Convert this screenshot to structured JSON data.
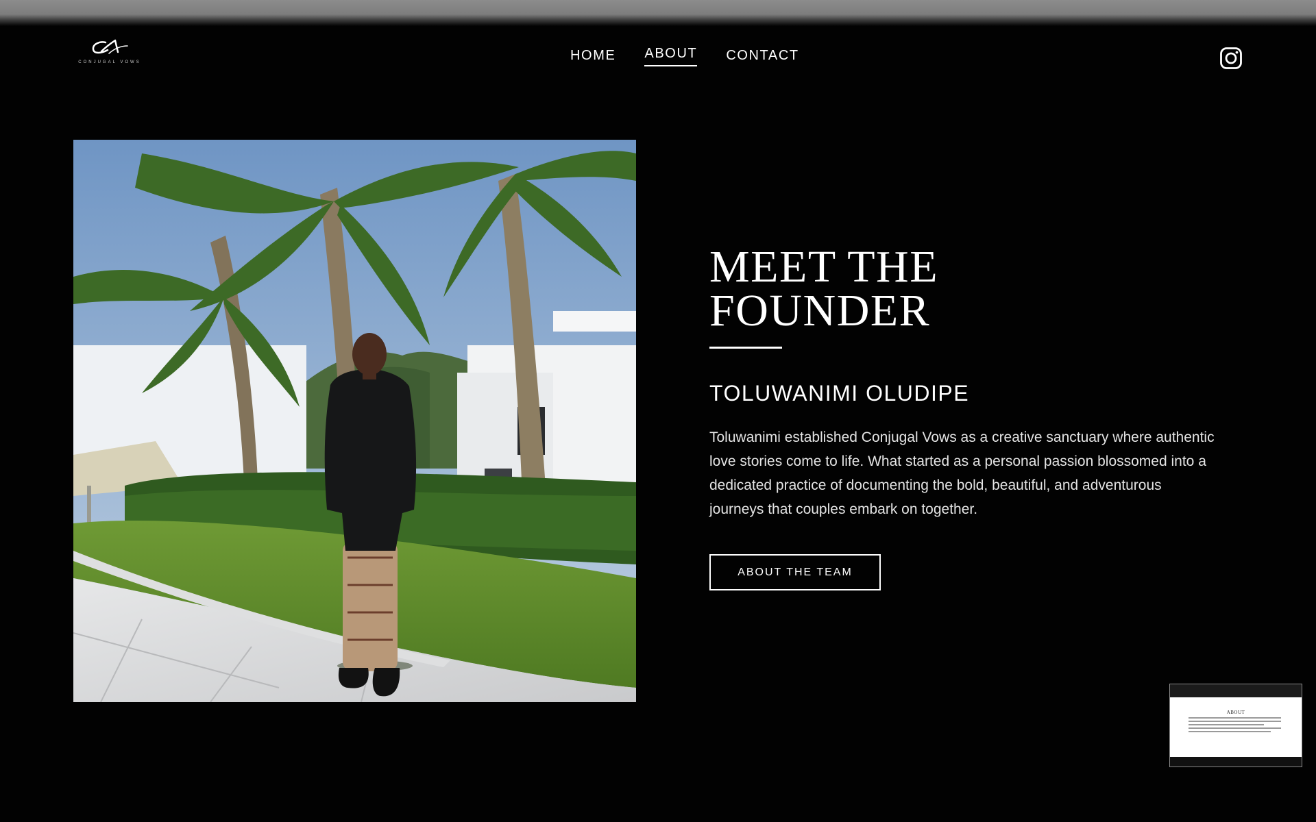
{
  "brand": {
    "monogram": "CV",
    "name": "CONJUGAL VOWS"
  },
  "nav": {
    "items": [
      {
        "label": "HOME",
        "active": false
      },
      {
        "label": "ABOUT",
        "active": true
      },
      {
        "label": "CONTACT",
        "active": false
      }
    ]
  },
  "social": {
    "icon": "instagram-icon"
  },
  "photo": {
    "icon": "founder-photo"
  },
  "hero": {
    "title": "MEET THE\nFOUNDER",
    "founder_name": "TOLUWANIMI OLUDIPE",
    "bio": "Toluwanimi established Conjugal Vows as a creative sanctuary where authentic love stories come to life. What started as a personal passion blossomed into a dedicated practice of documenting the bold, beautiful, and adventurous journeys that couples embark on together.",
    "button_label": "ABOUT THE TEAM"
  },
  "preview": {
    "title": "ABOUT"
  },
  "colors": {
    "background": "#020202",
    "text": "#ffffff",
    "topbar": "#8c8c8c"
  }
}
